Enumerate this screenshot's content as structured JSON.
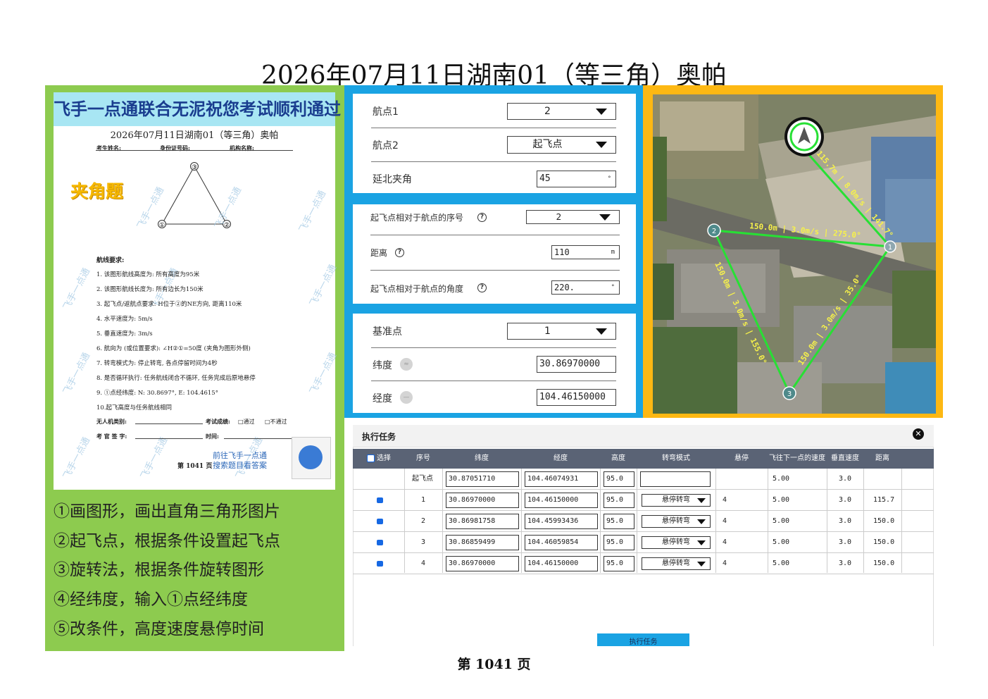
{
  "title": "2026年07月11日湖南01（等三角）奥帕",
  "sheet": {
    "banner": "飞手一点通联合无泥祝您考试顺利通过",
    "title": "2026年07月11日湖南01（等三角）奥帕",
    "field_name": "考生姓名:",
    "field_id": "身份证号码:",
    "field_org": "机构名称:",
    "topic": "夹角题",
    "triangle_labels": [
      "③",
      "①",
      "②"
    ],
    "req_heading": "航线要求:",
    "requirements": [
      "1. 该图形航线高度为: 所有高度为95米",
      "2. 该图形航线长度为: 所有边长为150米",
      "3. 起飞点/返航点要求: H位于②的NE方向, 距离110米",
      "4. 水平速度为: 5m/s",
      "5. 垂直速度为: 3m/s",
      "6. 航向为 (或位置要求): ∠H②①=50度 (夹角为图形外侧)",
      "7. 转弯模式为: 停止转弯, 各点停留时间为4秒",
      "8. 是否循环执行: 任务航线闭合不循环, 任务完成后原地悬停",
      "9. ①点经纬度: N: 30.8697°, E: 104.4615°",
      "10.起飞高度与任务航线相同"
    ],
    "uav_type": "无人机类别:",
    "exam_result": "考试成绩:",
    "pass": "□通过",
    "fail": "□不通过",
    "examiner": "考 官 签 字:",
    "time": "时间:",
    "page": "第 1041 页",
    "promo1": "前往飞手一点通",
    "promo2": "搜索题目看答案",
    "watermark": "飞手一点通"
  },
  "steps": [
    "①画图形，画出直角三角形图片",
    "②起飞点，根据条件设置起飞点",
    "③旋转法，根据条件旋转图形",
    "④经纬度，输入①点经纬度",
    "⑤改条件，高度速度悬停时间"
  ],
  "form1": {
    "wp1_label": "航点1",
    "wp1_value": "2",
    "wp2_label": "航点2",
    "wp2_value": "起飞点",
    "angle_label": "延北夹角",
    "angle_value": "45",
    "angle_unit": "°"
  },
  "form2": {
    "seq_label": "起飞点相对于航点的序号",
    "seq_value": "2",
    "dist_label": "距离",
    "dist_value": "110",
    "dist_unit": "m",
    "ang_label": "起飞点相对于航点的角度",
    "ang_value": "220.",
    "ang_unit": "°"
  },
  "form3": {
    "base_label": "基准点",
    "base_value": "1",
    "lat_label": "纬度",
    "lat_value": "30.86970000",
    "lon_label": "经度",
    "lon_value": "104.46150000"
  },
  "map": {
    "edge_12": "150.0m | 3.0m/s | 275.0°",
    "edge_23": "150.0m | 3.0m/s | 155.0°",
    "edge_31": "150.0m | 3.0m/s | 35.0°",
    "edge_h1": "115.7m | 8.0m/s | 141.7°",
    "nodes": [
      "1",
      "2",
      "3"
    ]
  },
  "task": {
    "title": "执行任务",
    "close": "✕",
    "headers": [
      "选择",
      "序号",
      "纬度",
      "经度",
      "高度",
      "转弯模式",
      "悬停",
      "飞往下一点的速度",
      "垂直速度",
      "距离"
    ],
    "rows": [
      {
        "seq": "起飞点",
        "lat": "30.87051710",
        "lon": "104.46074931",
        "alt": "95.0",
        "mode": "",
        "hover": "",
        "speed": "5.00",
        "vspeed": "3.0",
        "dist": ""
      },
      {
        "seq": "1",
        "lat": "30.86970000",
        "lon": "104.46150000",
        "alt": "95.0",
        "mode": "悬停转弯",
        "hover": "4",
        "speed": "5.00",
        "vspeed": "3.0",
        "dist": "115.7"
      },
      {
        "seq": "2",
        "lat": "30.86981758",
        "lon": "104.45993436",
        "alt": "95.0",
        "mode": "悬停转弯",
        "hover": "4",
        "speed": "5.00",
        "vspeed": "3.0",
        "dist": "150.0"
      },
      {
        "seq": "3",
        "lat": "30.86859499",
        "lon": "104.46059854",
        "alt": "95.0",
        "mode": "悬停转弯",
        "hover": "4",
        "speed": "5.00",
        "vspeed": "3.0",
        "dist": "150.0"
      },
      {
        "seq": "4",
        "lat": "30.86970000",
        "lon": "104.46150000",
        "alt": "95.0",
        "mode": "悬停转弯",
        "hover": "4",
        "speed": "5.00",
        "vspeed": "3.0",
        "dist": "150.0"
      }
    ],
    "exec_button": "执行任务"
  },
  "footer": "第 1041 页"
}
